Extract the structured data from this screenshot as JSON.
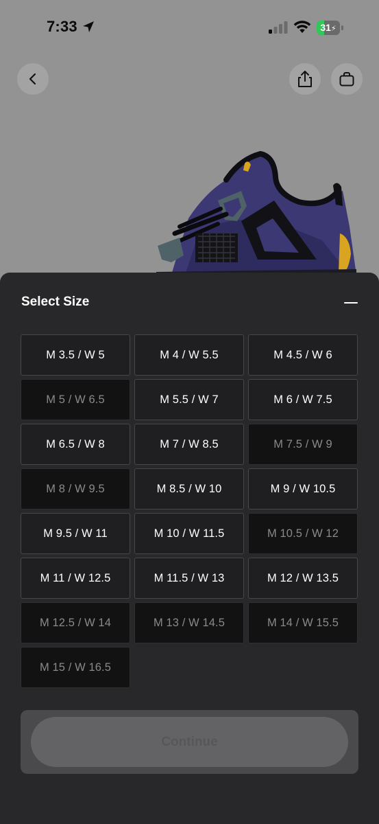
{
  "status_bar": {
    "time": "7:33",
    "battery_percent": "31",
    "battery_level": 0.31,
    "icons": [
      "location-arrow-icon",
      "cellular-signal-icon",
      "wifi-icon",
      "battery-charging-icon"
    ]
  },
  "top_actions": {
    "back_icon": "chevron-left-icon",
    "share_icon": "share-icon",
    "bag_icon": "shopping-bag-icon"
  },
  "sheet": {
    "title": "Select Size",
    "collapse_icon": "minus-icon",
    "sizes": [
      {
        "label": "M 3.5 / W 5",
        "available": true
      },
      {
        "label": "M 4 / W 5.5",
        "available": true
      },
      {
        "label": "M 4.5 / W 6",
        "available": true
      },
      {
        "label": "M 5 / W 6.5",
        "available": false
      },
      {
        "label": "M 5.5 / W 7",
        "available": true
      },
      {
        "label": "M 6 / W 7.5",
        "available": true
      },
      {
        "label": "M 6.5 / W 8",
        "available": true
      },
      {
        "label": "M 7 / W 8.5",
        "available": true
      },
      {
        "label": "M 7.5 / W 9",
        "available": false
      },
      {
        "label": "M 8 / W 9.5",
        "available": false
      },
      {
        "label": "M 8.5 / W 10",
        "available": true
      },
      {
        "label": "M 9 / W 10.5",
        "available": true
      },
      {
        "label": "M 9.5 / W 11",
        "available": true
      },
      {
        "label": "M 10 / W 11.5",
        "available": true
      },
      {
        "label": "M 10.5 / W 12",
        "available": false
      },
      {
        "label": "M 11 / W 12.5",
        "available": true
      },
      {
        "label": "M 11.5 / W 13",
        "available": true
      },
      {
        "label": "M 12 / W 13.5",
        "available": true
      },
      {
        "label": "M 12.5 / W 14",
        "available": false
      },
      {
        "label": "M 13 / W 14.5",
        "available": false
      },
      {
        "label": "M 14 / W 15.5",
        "available": false
      },
      {
        "label": "M 15 / W 16.5",
        "available": false
      }
    ],
    "continue_label": "Continue",
    "continue_enabled": false
  },
  "colors": {
    "sheet_background": "#28282a",
    "available_cell": "#1f1f21",
    "unavailable_cell": "#121213",
    "battery_green": "#33c759",
    "shoe_purple": "#3b3874",
    "shoe_gold": "#d9a520"
  }
}
